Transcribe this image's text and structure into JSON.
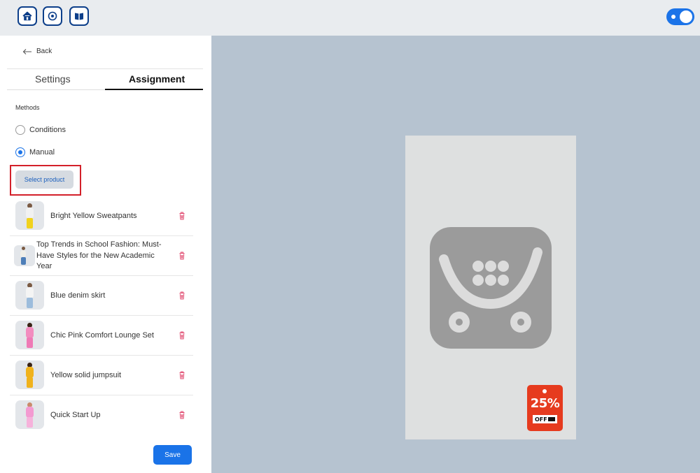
{
  "topbar": {
    "nav_icons": [
      "home-icon",
      "settings-icon",
      "book-icon"
    ],
    "theme_toggle": {
      "state": "on",
      "icon": "sun-icon"
    }
  },
  "sidebar": {
    "back_label": "Back",
    "tabs": [
      {
        "label": "Settings",
        "active": false
      },
      {
        "label": "Assignment",
        "active": true
      }
    ],
    "methods_label": "Methods",
    "methods": [
      {
        "label": "Conditions",
        "selected": false
      },
      {
        "label": "Manual",
        "selected": true
      }
    ],
    "select_product_label": "Select product",
    "products": [
      {
        "name": "Bright Yellow Sweatpants",
        "colors": [
          "#f1f1f1",
          "#f1d21d"
        ]
      },
      {
        "name": "Top Trends in School Fashion: Must-Have Styles for the New Academic Year",
        "colors": [
          "#f0efe9",
          "#4e7fb8"
        ]
      },
      {
        "name": "Blue denim skirt",
        "colors": [
          "#f4f4f4",
          "#9cbcdc"
        ]
      },
      {
        "name": "Chic Pink Comfort Lounge Set",
        "colors": [
          "#f28cbf",
          "#ef7ab6"
        ]
      },
      {
        "name": "Yellow solid jumpsuit",
        "colors": [
          "#f0b21c",
          "#f0b21c"
        ]
      },
      {
        "name": "Quick Start Up",
        "colors": [
          "#f39ad1",
          "#f6b2db"
        ]
      }
    ],
    "save_label": "Save"
  },
  "preview": {
    "placeholder_icon": "shopping-basket-icon",
    "badge": {
      "percent": "25%",
      "off": "OFF"
    },
    "colors": {
      "background": "#b6c3d0",
      "badge": "#e63b1e",
      "accent": "#1a73e8"
    }
  }
}
